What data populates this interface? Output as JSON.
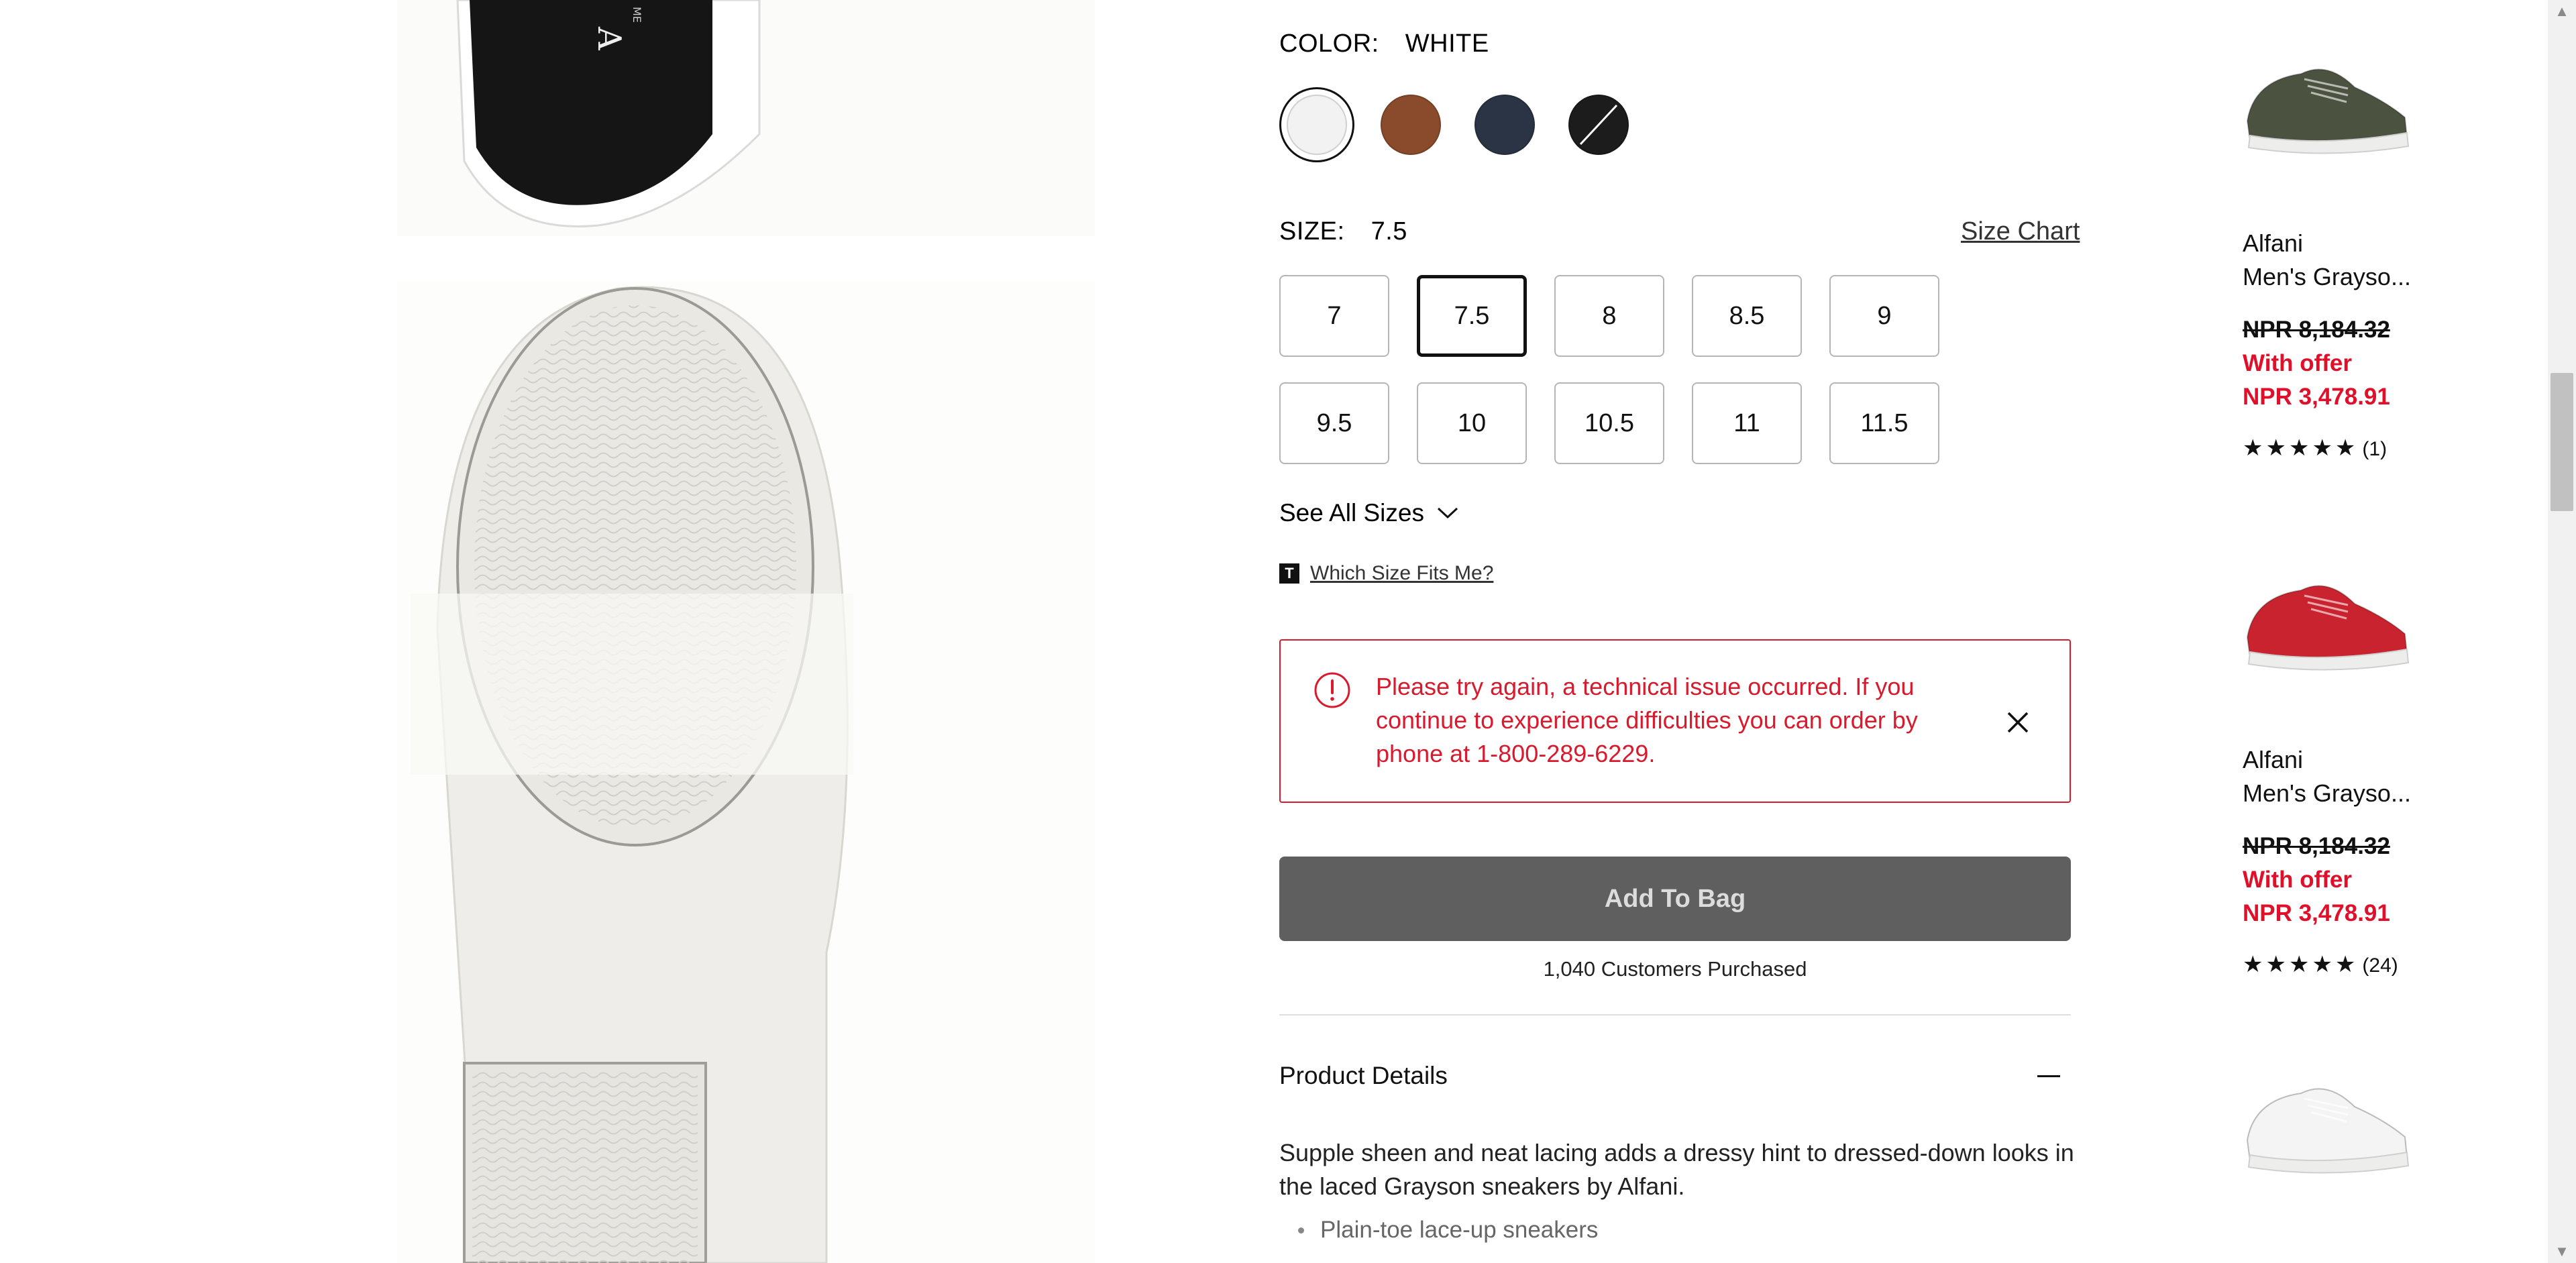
{
  "gallery": {
    "shoe_logo_text": "A",
    "shoe_logo_sub": "ME"
  },
  "color": {
    "label": "COLOR:",
    "value": "WHITE",
    "swatches": [
      {
        "name": "White",
        "hex": "#f2f2f2",
        "selected": true
      },
      {
        "name": "Brown",
        "hex": "#8a4a2c",
        "selected": false
      },
      {
        "name": "Navy",
        "hex": "#2b3444",
        "selected": false
      },
      {
        "name": "Black",
        "hex": "#1c1c1c",
        "selected": false,
        "unavailable": true
      }
    ]
  },
  "size": {
    "label": "SIZE:",
    "value": "7.5",
    "chart_link": "Size Chart",
    "options": [
      "7",
      "7.5",
      "8",
      "8.5",
      "9",
      "9.5",
      "10",
      "10.5",
      "11",
      "11.5"
    ],
    "selected": "7.5",
    "see_all": "See All Sizes",
    "fit_link": "Which Size Fits Me?",
    "fit_badge": "T"
  },
  "alert": {
    "message": "Please try again, a technical issue occurred. If you continue to experience difficulties you can order by phone at 1-800-289-6229.",
    "color": "#d9192c"
  },
  "purchase": {
    "add_to_bag": "Add To Bag",
    "customers_purchased": "1,040 Customers Purchased"
  },
  "details": {
    "title": "Product Details",
    "description": "Supple sheen and neat lacing adds a dressy hint to dressed-down looks in the laced Grayson sneakers by Alfani.",
    "bullets": [
      "Plain-toe lace-up sneakers"
    ]
  },
  "recommendations": [
    {
      "brand": "Alfani",
      "name": "Men's Grayso...",
      "old_price": "NPR 8,184.32",
      "offer_label": "With offer",
      "offer_price": "NPR 3,478.91",
      "stars": "★★★★★",
      "count": "(1)",
      "color": "#4b5240"
    },
    {
      "brand": "Alfani",
      "name": "Men's Grayso...",
      "old_price": "NPR 8,184.32",
      "offer_label": "With offer",
      "offer_price": "NPR 3,478.91",
      "stars": "★★★★★",
      "count": "(24)",
      "color": "#c8232f"
    },
    {
      "color": "#f4f4f4"
    }
  ],
  "theme": {
    "error": "#d9192c",
    "offer": "#e0102a",
    "button": "#5f5f5f"
  }
}
